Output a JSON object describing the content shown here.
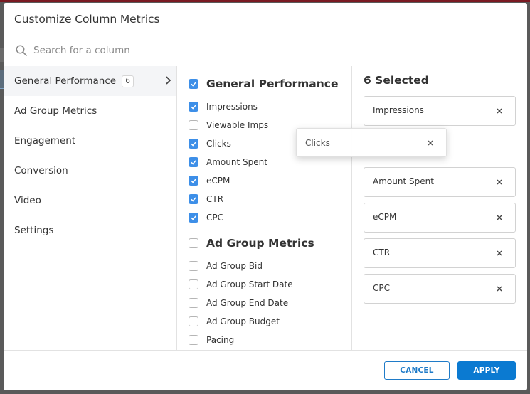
{
  "modal": {
    "title": "Customize Column Metrics"
  },
  "search": {
    "placeholder": "Search for a column",
    "value": "",
    "icon": "search-icon"
  },
  "nav": {
    "items": [
      {
        "label": "General Performance",
        "badge": "6",
        "active": true
      },
      {
        "label": "Ad Group Metrics"
      },
      {
        "label": "Engagement"
      },
      {
        "label": "Conversion"
      },
      {
        "label": "Video"
      },
      {
        "label": "Settings"
      }
    ]
  },
  "groups": [
    {
      "title": "General Performance",
      "checked": true,
      "options": [
        {
          "label": "Impressions",
          "checked": true
        },
        {
          "label": "Viewable Imps",
          "checked": false
        },
        {
          "label": "Clicks",
          "checked": true
        },
        {
          "label": "Amount Spent",
          "checked": true
        },
        {
          "label": "eCPM",
          "checked": true
        },
        {
          "label": "CTR",
          "checked": true
        },
        {
          "label": "CPC",
          "checked": true
        }
      ]
    },
    {
      "title": "Ad Group Metrics",
      "checked": false,
      "options": [
        {
          "label": "Ad Group Bid",
          "checked": false
        },
        {
          "label": "Ad Group Start Date",
          "checked": false
        },
        {
          "label": "Ad Group End Date",
          "checked": false
        },
        {
          "label": "Ad Group Budget",
          "checked": false
        },
        {
          "label": "Pacing",
          "checked": false
        }
      ]
    }
  ],
  "selected": {
    "title": "6 Selected",
    "items": [
      {
        "label": "Impressions"
      },
      {
        "label": "Clicks",
        "dragging": true
      },
      {
        "label": "Amount Spent"
      },
      {
        "label": "eCPM"
      },
      {
        "label": "CTR"
      },
      {
        "label": "CPC"
      }
    ],
    "dragging_label": "Clicks"
  },
  "footer": {
    "cancel_label": "CANCEL",
    "apply_label": "APPLY"
  },
  "colors": {
    "accent": "#0b7ad1",
    "checkbox": "#3d8fe8"
  }
}
